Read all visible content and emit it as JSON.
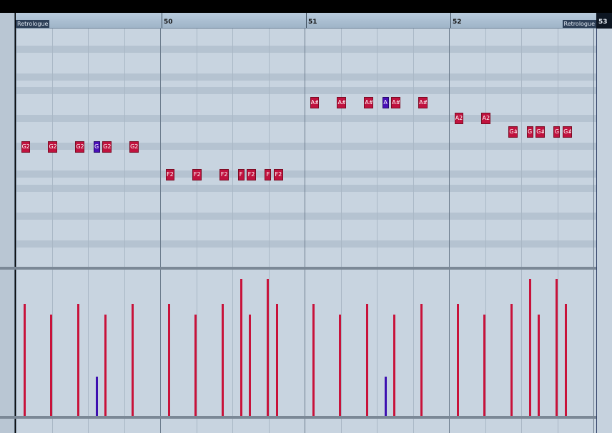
{
  "ruler": {
    "bars": [
      {
        "label": "50"
      },
      {
        "label": "51"
      },
      {
        "label": "52"
      }
    ],
    "end_bar": "53",
    "left_locator": "Retrologue",
    "right_locator": "Retrologue"
  },
  "notes": [
    {
      "label": "G2",
      "pitch_row": 4,
      "start_beat": 0.15,
      "len": 0.25,
      "vel": 100
    },
    {
      "label": "G2",
      "pitch_row": 4,
      "start_beat": 0.9,
      "len": 0.25,
      "vel": 90
    },
    {
      "label": "G2",
      "pitch_row": 4,
      "start_beat": 1.65,
      "len": 0.25,
      "vel": 100
    },
    {
      "label": "G",
      "pitch_row": 4,
      "start_beat": 2.15,
      "len": 0.15,
      "vel": 35,
      "selected": true
    },
    {
      "label": "G2",
      "pitch_row": 4,
      "start_beat": 2.4,
      "len": 0.25,
      "vel": 90
    },
    {
      "label": "G2",
      "pitch_row": 4,
      "start_beat": 3.15,
      "len": 0.25,
      "vel": 100
    },
    {
      "label": "F2",
      "pitch_row": 5,
      "start_beat": 4.15,
      "len": 0.25,
      "vel": 100
    },
    {
      "label": "F2",
      "pitch_row": 5,
      "start_beat": 4.9,
      "len": 0.25,
      "vel": 90
    },
    {
      "label": "F2",
      "pitch_row": 5,
      "start_beat": 5.65,
      "len": 0.25,
      "vel": 100
    },
    {
      "label": "F",
      "pitch_row": 5,
      "start_beat": 6.15,
      "len": 0.15,
      "vel": 122
    },
    {
      "label": "F2",
      "pitch_row": 5,
      "start_beat": 6.4,
      "len": 0.25,
      "vel": 90
    },
    {
      "label": "F",
      "pitch_row": 5,
      "start_beat": 6.9,
      "len": 0.15,
      "vel": 122
    },
    {
      "label": "F2",
      "pitch_row": 5,
      "start_beat": 7.15,
      "len": 0.25,
      "vel": 100
    },
    {
      "label": "A#",
      "pitch_row": 1,
      "start_beat": 8.15,
      "len": 0.25,
      "vel": 100
    },
    {
      "label": "A#",
      "pitch_row": 1,
      "start_beat": 8.9,
      "len": 0.25,
      "vel": 90
    },
    {
      "label": "A#",
      "pitch_row": 1,
      "start_beat": 9.65,
      "len": 0.25,
      "vel": 100
    },
    {
      "label": "A",
      "pitch_row": 1,
      "start_beat": 10.15,
      "len": 0.15,
      "vel": 35,
      "selected": true
    },
    {
      "label": "A#",
      "pitch_row": 1,
      "start_beat": 10.4,
      "len": 0.25,
      "vel": 90
    },
    {
      "label": "A#",
      "pitch_row": 1,
      "start_beat": 11.15,
      "len": 0.25,
      "vel": 100
    },
    {
      "label": "A2",
      "pitch_row": 2,
      "start_beat": 12.15,
      "len": 0.25,
      "vel": 100
    },
    {
      "label": "A2",
      "pitch_row": 2,
      "start_beat": 12.9,
      "len": 0.25,
      "vel": 90
    },
    {
      "label": "G#",
      "pitch_row": 3,
      "start_beat": 13.65,
      "len": 0.25,
      "vel": 100
    },
    {
      "label": "G",
      "pitch_row": 3,
      "start_beat": 14.15,
      "len": 0.15,
      "vel": 122
    },
    {
      "label": "G#",
      "pitch_row": 3,
      "start_beat": 14.4,
      "len": 0.25,
      "vel": 90
    },
    {
      "label": "G",
      "pitch_row": 3,
      "start_beat": 14.9,
      "len": 0.15,
      "vel": 122
    },
    {
      "label": "G#",
      "pitch_row": 3,
      "start_beat": 15.15,
      "len": 0.25,
      "vel": 100
    }
  ],
  "colors": {
    "note": "#c0123e",
    "note_selected": "#4a10b8",
    "grid_bg": "#c8d4e0",
    "ruler_bg": "#a9bdd0"
  }
}
